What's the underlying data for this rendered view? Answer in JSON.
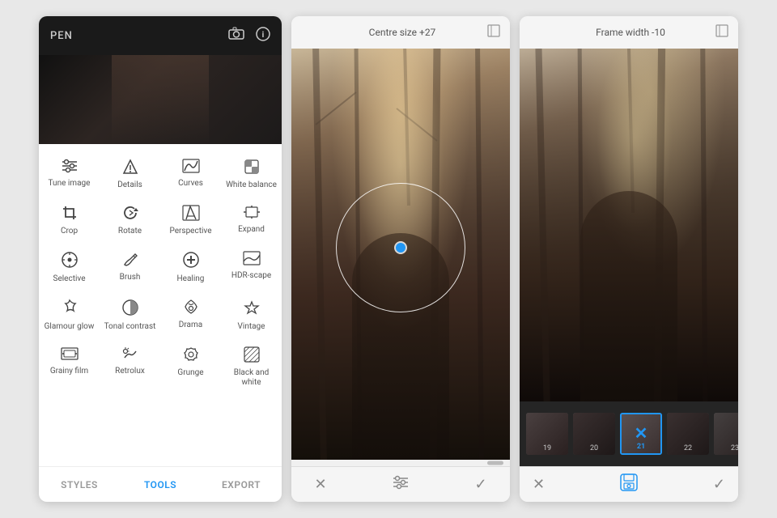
{
  "leftPanel": {
    "topBar": {
      "label": "PEN",
      "cameraIconLabel": "camera-icon",
      "infoIconLabel": "info-icon"
    },
    "bottomNav": {
      "items": [
        {
          "label": "STYLES",
          "active": false
        },
        {
          "label": "TOOLS",
          "active": true
        },
        {
          "label": "EXPORT",
          "active": false
        }
      ]
    },
    "toolRows": [
      [
        {
          "icon": "tune",
          "label": "Tune image"
        },
        {
          "icon": "details",
          "label": "Details"
        },
        {
          "icon": "curves",
          "label": "Curves"
        },
        {
          "icon": "wb",
          "label": "White balance"
        }
      ],
      [
        {
          "icon": "crop",
          "label": "Crop"
        },
        {
          "icon": "rotate",
          "label": "Rotate"
        },
        {
          "icon": "perspective",
          "label": "Perspective"
        },
        {
          "icon": "expand",
          "label": "Expand"
        }
      ],
      [
        {
          "icon": "selective",
          "label": "Selective"
        },
        {
          "icon": "brush",
          "label": "Brush"
        },
        {
          "icon": "healing",
          "label": "Healing"
        },
        {
          "icon": "hdrscape",
          "label": "HDR-scape"
        }
      ],
      [
        {
          "icon": "glamour",
          "label": "Glamour glow"
        },
        {
          "icon": "tonal",
          "label": "Tonal contrast"
        },
        {
          "icon": "drama",
          "label": "Drama"
        },
        {
          "icon": "vintage",
          "label": "Vintage"
        }
      ],
      [
        {
          "icon": "grainyfilm",
          "label": "Grainy film"
        },
        {
          "icon": "retrolux",
          "label": "Retrolux"
        },
        {
          "icon": "grunge",
          "label": "Grunge"
        },
        {
          "icon": "bw",
          "label": "Black and white"
        }
      ]
    ]
  },
  "middlePanel": {
    "header": {
      "title": "Centre size +27",
      "expandIcon": "⊡"
    },
    "bottomBar": {
      "cancelLabel": "✕",
      "adjustLabel": "⊟",
      "checkLabel": "✓"
    }
  },
  "rightPanel": {
    "header": {
      "title": "Frame width -10",
      "expandIcon": "⊡"
    },
    "filmStrip": {
      "thumbs": [
        {
          "num": "19",
          "active": false
        },
        {
          "num": "20",
          "active": false
        },
        {
          "num": "21",
          "active": true
        },
        {
          "num": "22",
          "active": false
        },
        {
          "num": "23",
          "active": false
        }
      ]
    },
    "bottomBar": {
      "cancelLabel": "✕",
      "saveLabel": "💾",
      "checkLabel": "✓"
    }
  },
  "colors": {
    "accent": "#2196F3",
    "toolsActive": "#2196F3",
    "text": "#555555",
    "bg": "#e8e8e8"
  }
}
